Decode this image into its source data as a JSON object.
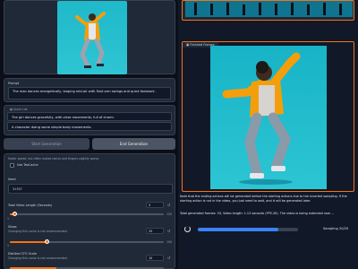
{
  "prompt": {
    "label": "Prompt",
    "value": "The man dances energetically, leaping mid-air with fluid arm swings and quick footwork."
  },
  "quick_list": {
    "label": "Quick List",
    "items": [
      "The girl dances gracefully, with clear movements, full of charm.",
      "A character doing some simple body movements."
    ]
  },
  "actions": {
    "start_label": "Start Generation",
    "end_label": "End Generation"
  },
  "teacache": {
    "hint": "Faster speed, but often makes hands and fingers slightly worse.",
    "label": "Use TeaCache"
  },
  "seed": {
    "label": "Seed",
    "value": "31337"
  },
  "video_length": {
    "label": "Total Video Length (Seconds)",
    "value": "5",
    "min": "1",
    "max": "120",
    "fraction": 0.034
  },
  "steps": {
    "label": "Steps",
    "hint": "Changing this value is not recommended.",
    "value": "25",
    "min": "1",
    "max": "100",
    "fraction": 0.24
  },
  "cfg": {
    "label": "Distilled CFG Scale",
    "hint": "Changing this value is not recommended.",
    "value": "10",
    "fraction": 0.3
  },
  "finished_frames": {
    "label": "Finished Frames"
  },
  "note": "Note that the ending actions will be generated before the starting actions due to the inverted sampling. If the starting action is not in the video, you just need to wait, and it will be generated later.",
  "totals": "Total generated frames: 33, Video length: 1.13 seconds (FPS-30). The video is being extended now ...",
  "sampling": {
    "label": "Sampling 20/25",
    "fraction": 0.8
  },
  "colors": {
    "accent": "#f97316",
    "progress": "#3b82f6",
    "background": "#0b0f19"
  }
}
